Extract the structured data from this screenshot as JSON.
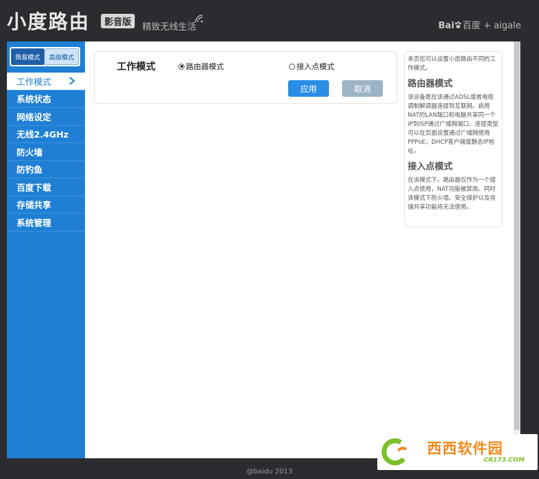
{
  "header": {
    "brand": "小度路由",
    "edition": "影音版",
    "slogan": "精致无线生活",
    "partner_bai": "Bai",
    "partner_du": "百度",
    "partner_rest": "+ aigale"
  },
  "sidebar": {
    "mode_simple": "简易模式",
    "mode_advanced": "高级模式",
    "items": [
      {
        "label": "工作模式",
        "active": true
      },
      {
        "label": "系统状态"
      },
      {
        "label": "网络设定"
      },
      {
        "label": "无线2.4GHz"
      },
      {
        "label": "防火墙"
      },
      {
        "label": "防钓鱼"
      },
      {
        "label": "百度下载"
      },
      {
        "label": "存储共享"
      },
      {
        "label": "系统管理"
      }
    ]
  },
  "main": {
    "title": "工作模式",
    "option_router": "路由器模式",
    "option_ap": "接入点模式",
    "selected": "路由器模式",
    "apply": "应用",
    "cancel": "取消"
  },
  "help": {
    "intro": "本页您可以设置小度路由不同的工作模式。",
    "router_title": "路由器模式",
    "router_text": "该设备是应该通过ADSL或者电缆调制解调器连接到互联网。启用NAT的LAN端口和电脑共享同一个IP到ISP通过广域网端口。连接类型可以在页面设置通过广域网使用PPPoE，DHCP客户端或静态IP地址。",
    "ap_title": "接入点模式",
    "ap_text": "在该模式下，路由器仅作为一个接入点使用，NAT功能被禁用。同时该模式下防火墙、安全保护以及存储共享功能将无法使用。"
  },
  "footer": "@baidu 2013",
  "watermark": {
    "text": "西西软件园",
    "url": "CR173.COM"
  },
  "colors": {
    "sidebar": "#1f7fd4",
    "header": "#2a2c30",
    "apply": "#2a8ee6",
    "cancel": "#9db4c6"
  }
}
